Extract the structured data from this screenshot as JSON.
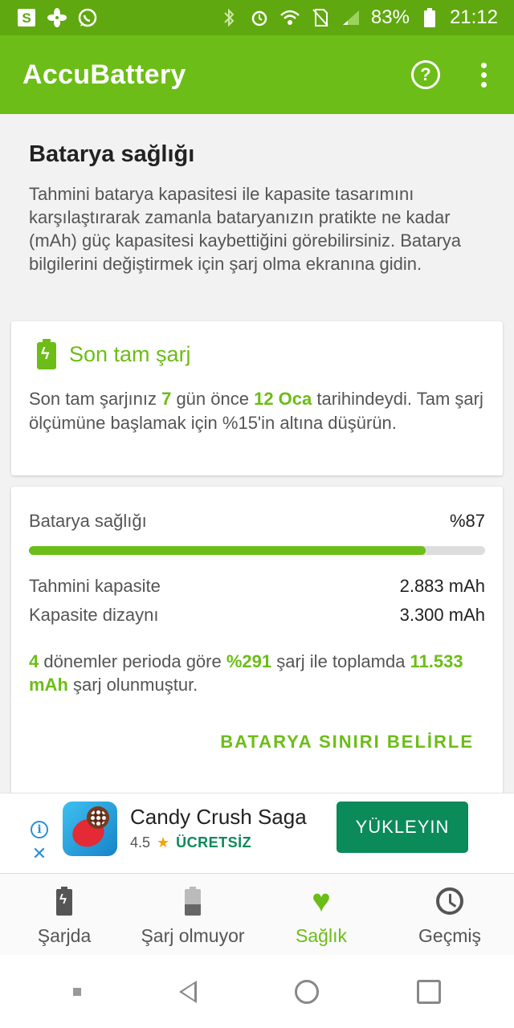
{
  "status_bar": {
    "left_icons": [
      "s-app-icon",
      "fan-icon",
      "whatsapp-icon"
    ],
    "battery_percent": "83%",
    "time": "21:12"
  },
  "app_bar": {
    "title": "AccuBattery",
    "help_glyph": "?"
  },
  "intro": {
    "title": "Batarya sağlığı",
    "description": "Tahmini batarya kapasitesi ile kapasite tasarımını karşılaştırarak zamanla bataryanızın pratikte ne kadar (mAh) güç kapasitesi kaybettiğini görebilirsiniz. Batarya bilgilerini değiştirmek için şarj olma ekranına gidin."
  },
  "last_charge": {
    "title": "Son tam şarj",
    "text_1": "Son tam şarjınız ",
    "days": "7",
    "text_2": " gün önce ",
    "date": "12 Oca",
    "text_3": " tarihindeydi. Tam şarj ölçümüne başlamak için %15'in altına düşürün."
  },
  "health": {
    "label": "Batarya sağlığı",
    "value": "%87",
    "percent": 87,
    "estimated_label": "Tahmini kapasite",
    "estimated_value": "2.883 mAh",
    "design_label": "Kapasite dizaynı",
    "design_value": "3.300 mAh",
    "summary_cycles": "4",
    "summary_text_1": " dönemler perioda göre ",
    "summary_percent": "%291",
    "summary_text_2": " şarj ile  toplamda ",
    "summary_total": "11.533 mAh",
    "summary_text_3": " şarj olunmuştur.",
    "action_label": "BATARYA SINIRI BELİRLE"
  },
  "ad": {
    "title": "Candy Crush Saga",
    "rating": "4.5",
    "price": "ÜCRETSİZ",
    "button": "YÜKLEYIN"
  },
  "bottom_nav": {
    "items": [
      {
        "label": "Şarjda",
        "icon": "battery-charging-icon"
      },
      {
        "label": "Şarj olmuyor",
        "icon": "battery-discharging-icon"
      },
      {
        "label": "Sağlık",
        "icon": "heart-icon"
      },
      {
        "label": "Geçmiş",
        "icon": "history-icon"
      }
    ],
    "active_index": 2
  },
  "colors": {
    "primary": "#6cbd17",
    "status_bar": "#5fa80f",
    "ad_green": "#0b8a5a"
  }
}
